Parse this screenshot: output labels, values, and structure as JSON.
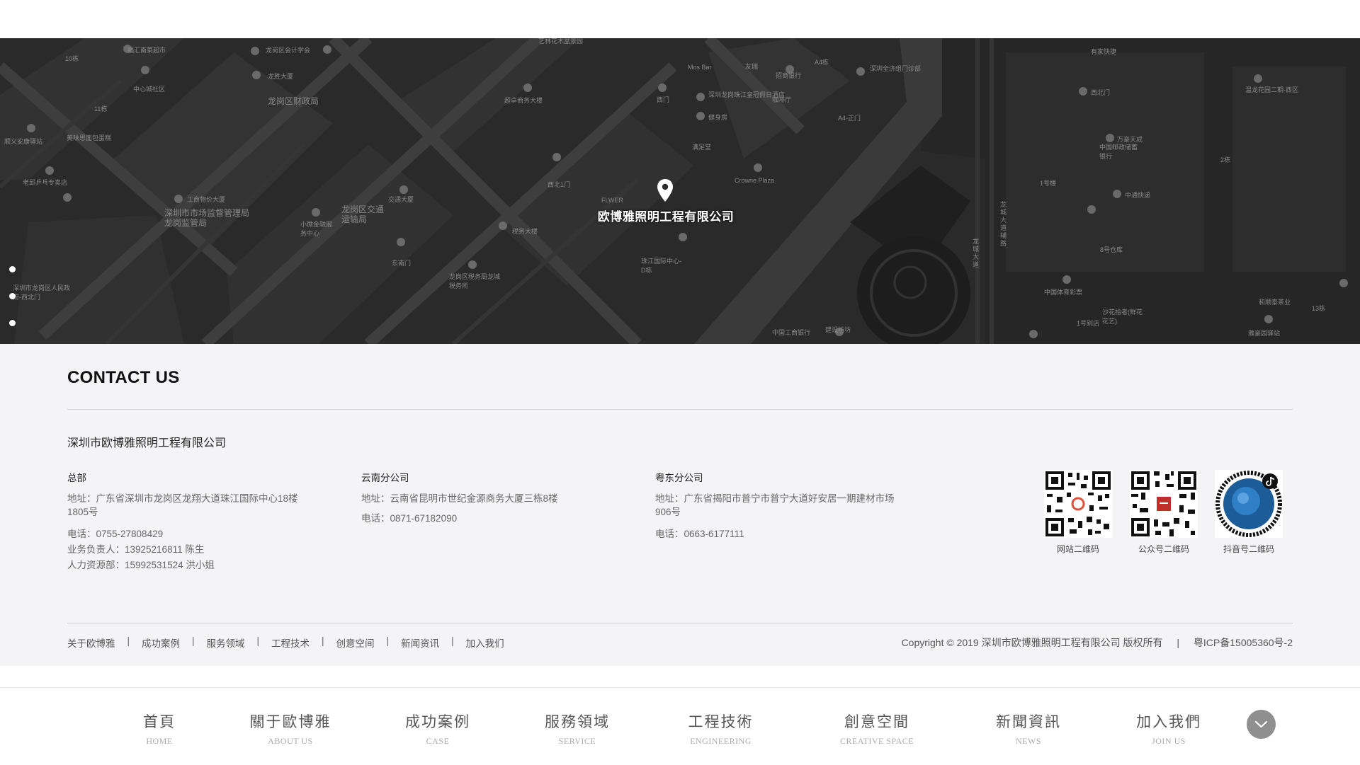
{
  "map": {
    "company_label": "欧博雅照明工程有限公司",
    "labels": [
      "福汇南菜超市",
      "龙岗区会计学会",
      "艺林花木盆景园",
      "中心城社区",
      "龙岗区财政局",
      "超卓商务大楼",
      "Mos Bar",
      "友瑞",
      "招商银行",
      "深圳全济组门诊部",
      "有家快捷",
      "西北门",
      "温龙花园二期-西区",
      "龙胜大厦",
      "深圳龙岗珠江皇冠假日酒店",
      "咖啡厅",
      "健身房",
      "西门",
      "满足堂",
      "A4-正门",
      "顺义安康驿站",
      "美味思面包蛋糕",
      "老邱乒乓专卖店",
      "工商物价大厦",
      "深圳市市场监督管理局龙岗监管局",
      "龙岗区交通运输局",
      "交通大厦",
      "西北1门",
      "FLWER",
      "Crowne Plaza",
      "中国邮政储蓄银行",
      "万豪天成",
      "中通快递",
      "小微金融服务中心",
      "税务大楼",
      "珠江国际中心-D栋",
      "东南门",
      "龙岗区税务局龙城税务所",
      "深圳市龙岗区人民政府-西北门",
      "龙城大道辅路",
      "中国体育彩票",
      "沙花拾者(鲜花花艺)",
      "8号仓库",
      "1号别店",
      "和顺泰茶业",
      "雅豪园驿站",
      "中国工商银行",
      "建设坊坊",
      "龙城大道",
      "10栋",
      "11栋",
      "A4栋",
      "13栋",
      "1号楼",
      "2栋"
    ]
  },
  "page_dots": [
    {
      "state": "filled"
    },
    {
      "state": "filled"
    },
    {
      "state": "filled"
    },
    {
      "state": "hollow"
    },
    {
      "state": "hollow"
    },
    {
      "state": "hollow"
    },
    {
      "state": "hollow"
    }
  ],
  "contact": {
    "title": "CONTACT US",
    "company": "深圳市欧博雅照明工程有限公司",
    "offices": [
      {
        "title": "总部",
        "address": "地址：广东省深圳市龙岗区龙翔大道珠江国际中心18楼1805号",
        "phone": "电话：0755-27808429",
        "business": "业务负责人：13925216811 陈生",
        "hr": "人力资源部：15992531524 洪小姐"
      },
      {
        "title": "云南分公司",
        "address": "地址：云南省昆明市世纪金源商务大厦三栋8楼",
        "phone": "电话：0871-67182090"
      },
      {
        "title": "粤东分公司",
        "address": "地址：广东省揭阳市普宁市普宁大道好安居一期建材市场906号",
        "phone": "电话：0663-6177111"
      }
    ],
    "qr_codes": [
      {
        "caption": "网站二维码",
        "icon": "qr-website-icon"
      },
      {
        "caption": "公众号二维码",
        "icon": "qr-wechat-icon"
      },
      {
        "caption": "抖音号二维码",
        "icon": "qr-douyin-icon"
      }
    ]
  },
  "footer": {
    "links": [
      "关于欧博雅",
      "成功案例",
      "服务领域",
      "工程技术",
      "创意空间",
      "新闻资讯",
      "加入我们"
    ],
    "separator": "|",
    "copyright": "Copyright © 2019 深圳市欧博雅照明工程有限公司 版权所有",
    "icp": "粤ICP备15005360号-2"
  },
  "nav": {
    "items": [
      {
        "cn": "首頁",
        "en": "HOME"
      },
      {
        "cn": "關于歐博雅",
        "en": "ABOUT US"
      },
      {
        "cn": "成功案例",
        "en": "CASE"
      },
      {
        "cn": "服務領域",
        "en": "SERVICE"
      },
      {
        "cn": "工程技術",
        "en": "ENGINEERING"
      },
      {
        "cn": "創意空間",
        "en": "CREATIVE SPACE"
      },
      {
        "cn": "新聞資訊",
        "en": "NEWS"
      },
      {
        "cn": "加入我們",
        "en": "JOIN US"
      }
    ],
    "scroll_icon": "chevron-down-icon"
  },
  "colors": {
    "map_bg": "#2b2b2b",
    "contact_bg": "#f4f4f6",
    "nav_button": "#8f8f8f"
  }
}
